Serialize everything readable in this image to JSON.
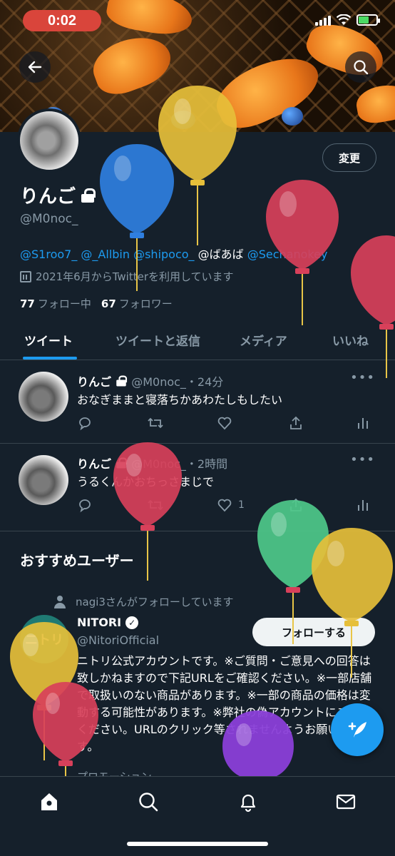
{
  "status": {
    "time": "0:02"
  },
  "profile": {
    "name": "りんご",
    "handle": "@M0noc_",
    "edit_label": "変更",
    "bio_mentions": [
      "@S1roo7_",
      "@_Allbin",
      "@shipoco_"
    ],
    "bio_text": "@ばあば",
    "bio_trailing_mention": "@Sechanokey",
    "joined": "2021年6月からTwitterを利用しています",
    "following_count": "77",
    "following_label": "フォロー中",
    "followers_count": "67",
    "followers_label": "フォロワー"
  },
  "tabs": [
    "ツイート",
    "ツイートと返信",
    "メディア",
    "いいね"
  ],
  "tweets": [
    {
      "name": "りんご",
      "handle_time": "@M0noc_・24分",
      "text": "おなぎままと寝落ちかあわたしもしたい",
      "likes": ""
    },
    {
      "name": "りんご",
      "handle_time": "@M0noc_・2時間",
      "text": "うるくんかおちっさまじで",
      "likes": "1"
    }
  ],
  "recommend": {
    "title": "おすすめユーザー",
    "note": "nagi3さんがフォローしています",
    "user_name": "NITORI",
    "user_handle": "@NitoriOfficial",
    "avatar_text": "ニトリ",
    "follow_label": "フォローする",
    "bio": "ニトリ公式アカウントです。※ご質問・ご意見への回答は致しかねますので下記URLをご確認ください。※一部店舗で取扱いのない商品があります。※一部の商品の価格は変動する可能性があります。※弊社の偽アカウントにご注意ください。URLのクリック等されませんようお願いします。",
    "promo": "プロモーション"
  },
  "colors": {
    "background": "#15202b",
    "accent": "#1d9bf0",
    "muted": "#8899a6",
    "divider": "#38444d"
  },
  "icons": [
    "back-arrow-icon",
    "search-icon",
    "lock-icon",
    "calendar-icon",
    "reply-icon",
    "retweet-icon",
    "like-icon",
    "share-icon",
    "analytics-icon",
    "person-icon",
    "verified-icon",
    "compose-icon",
    "home-icon",
    "explore-icon",
    "notifications-icon",
    "messages-icon"
  ]
}
